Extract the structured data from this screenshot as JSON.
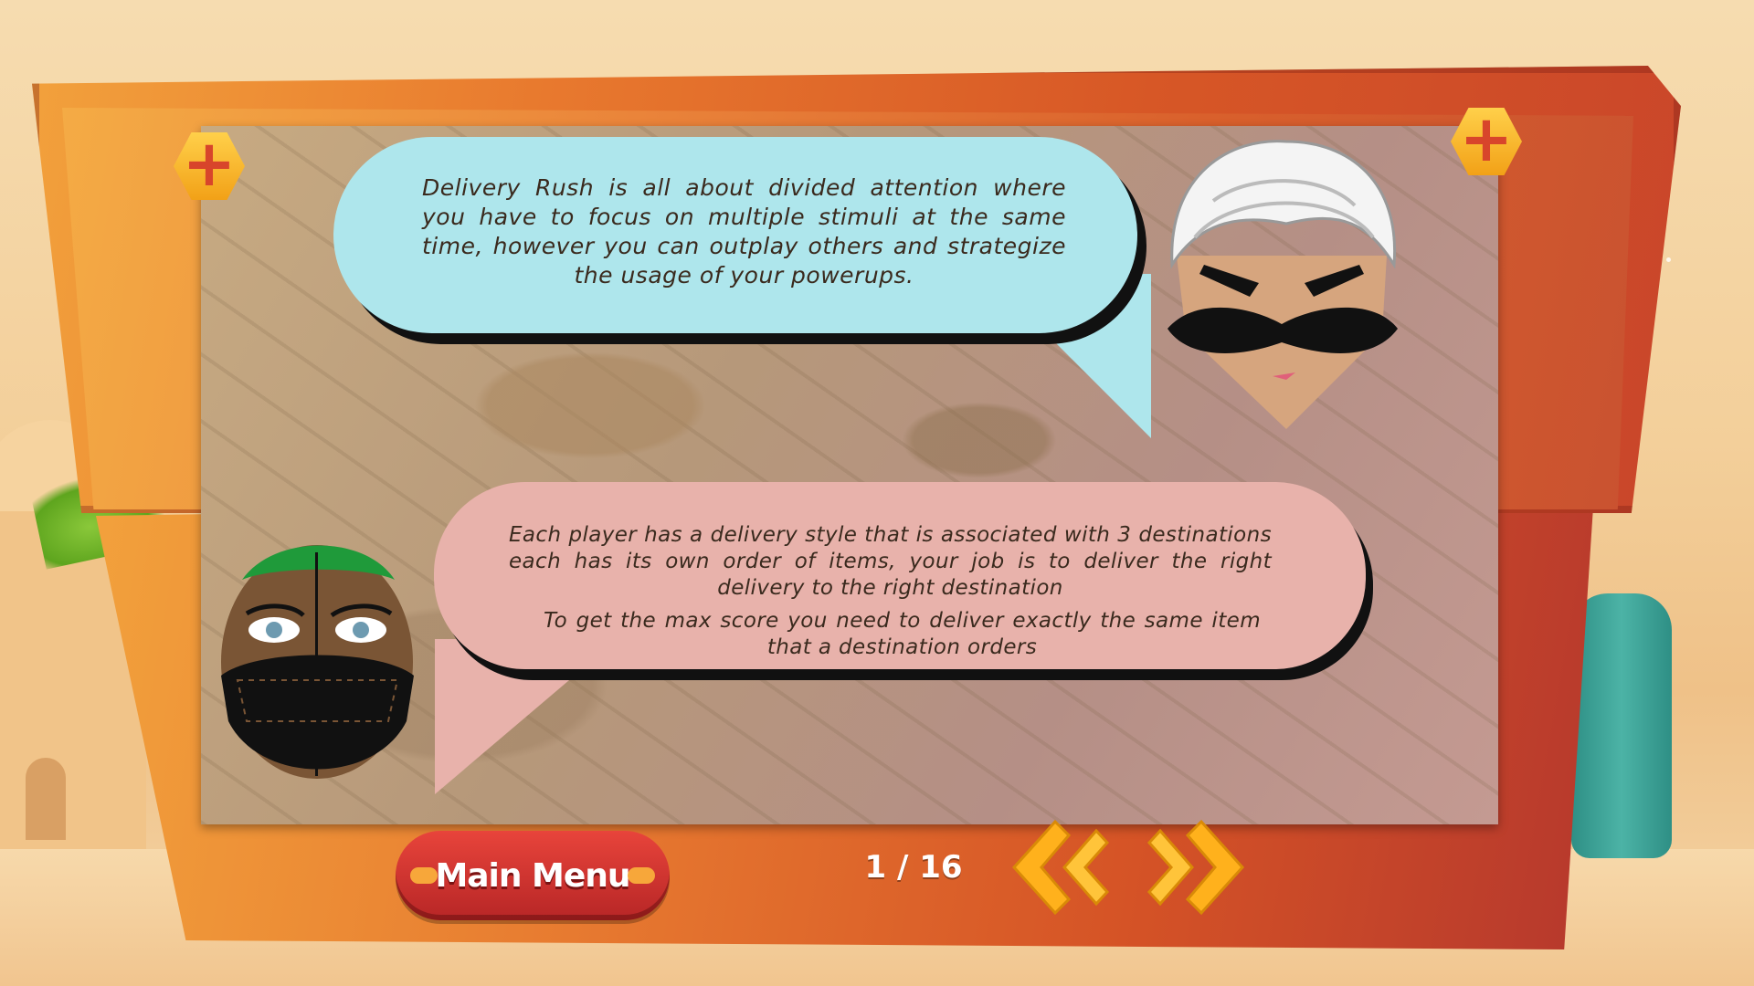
{
  "instructions": {
    "bubble1_text": "Delivery Rush is all about divided attention where you have to focus on multiple stimuli at the same time, however you can outplay others and strategize the usage of your powerups.",
    "bubble2_text1": "Each player has a delivery style that is associated with 3 destinations each has its own order of items, your job is to deliver the right delivery to the right destination",
    "bubble2_text2": "To get the max score you need to deliver exactly the same item that a destination orders"
  },
  "footer": {
    "main_menu_label": "Main Menu",
    "page_indicator": "1 / 16",
    "prev_icon": "double-chevron-left",
    "next_icon": "double-chevron-right"
  },
  "colors": {
    "bubble1": "#aee6ec",
    "bubble2": "#e8b2ab",
    "board": "#e8792e",
    "button": "#d63530",
    "arrow": "#ffb11c"
  }
}
